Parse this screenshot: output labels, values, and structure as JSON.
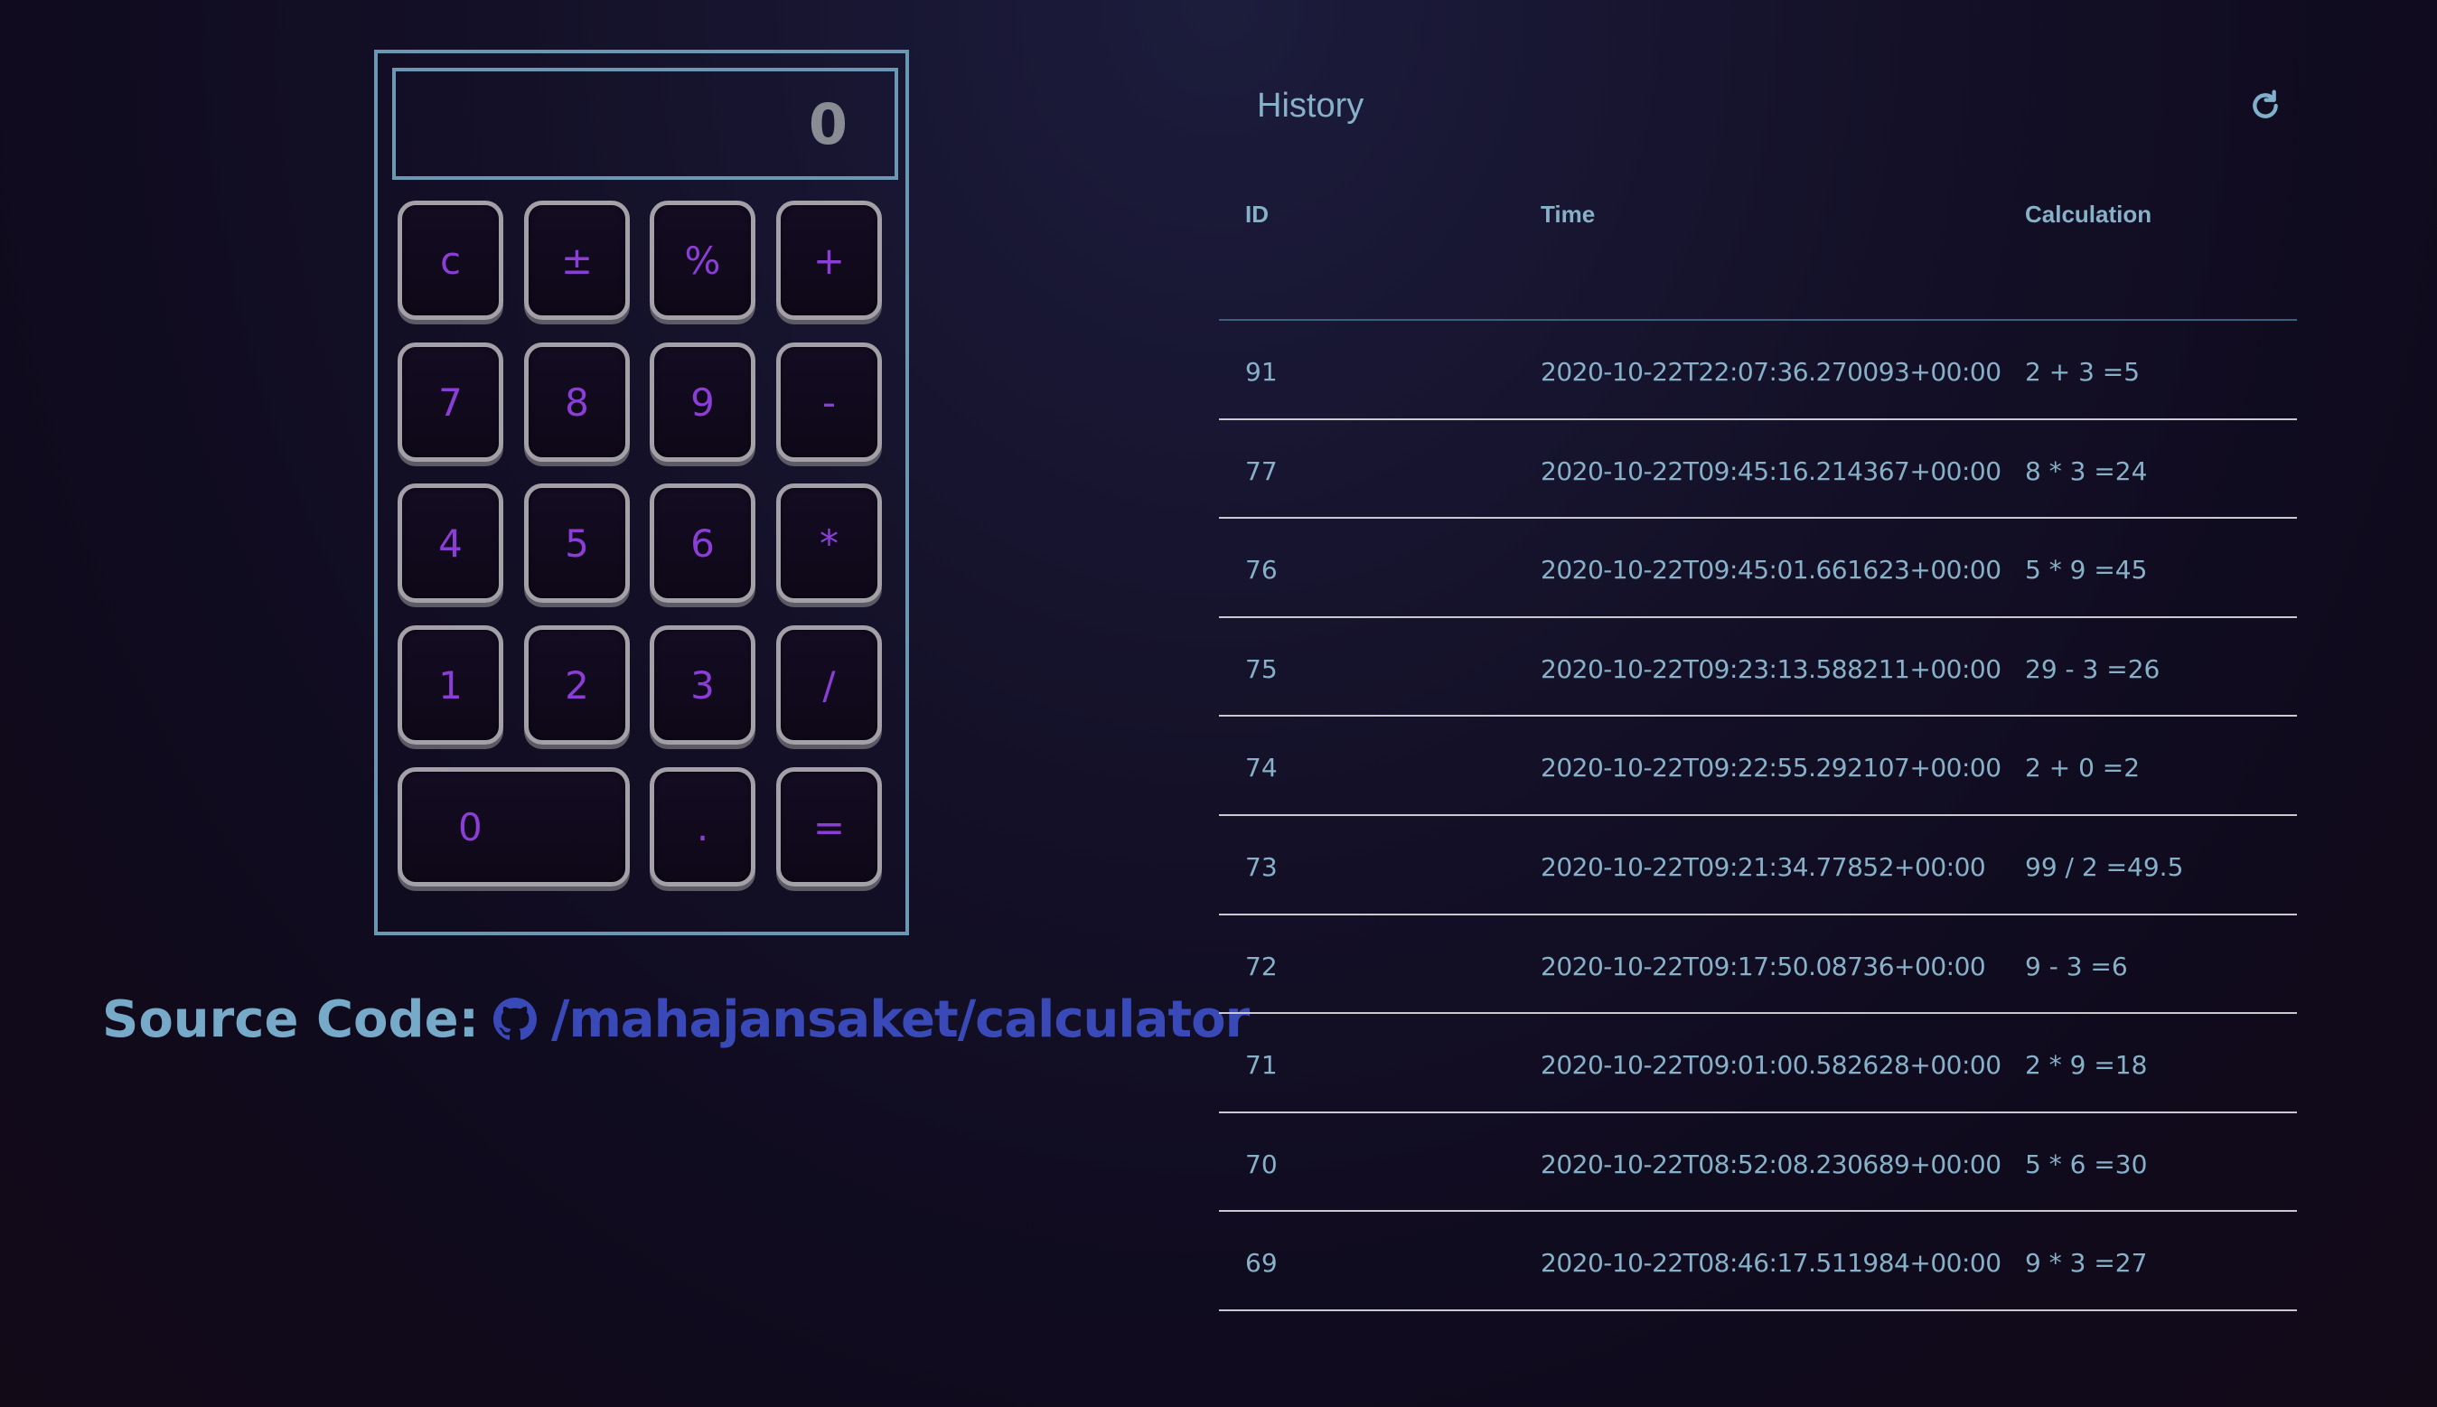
{
  "calculator": {
    "display_value": "0",
    "keys": [
      {
        "label": "c",
        "name": "clear-key"
      },
      {
        "label": "±",
        "name": "sign-toggle-key"
      },
      {
        "label": "%",
        "name": "percent-key"
      },
      {
        "label": "+",
        "name": "add-key"
      },
      {
        "label": "7",
        "name": "digit-7-key"
      },
      {
        "label": "8",
        "name": "digit-8-key"
      },
      {
        "label": "9",
        "name": "digit-9-key"
      },
      {
        "label": "-",
        "name": "subtract-key"
      },
      {
        "label": "4",
        "name": "digit-4-key"
      },
      {
        "label": "5",
        "name": "digit-5-key"
      },
      {
        "label": "6",
        "name": "digit-6-key"
      },
      {
        "label": "*",
        "name": "multiply-key"
      },
      {
        "label": "1",
        "name": "digit-1-key"
      },
      {
        "label": "2",
        "name": "digit-2-key"
      },
      {
        "label": "3",
        "name": "digit-3-key"
      },
      {
        "label": "/",
        "name": "divide-key"
      },
      {
        "label": "0",
        "name": "digit-0-key"
      },
      {
        "label": ".",
        "name": "decimal-key"
      },
      {
        "label": "=",
        "name": "equals-key"
      }
    ]
  },
  "source": {
    "label": "Source Code:",
    "link_text": "/mahajansaket/calculator",
    "icon": "github-icon"
  },
  "history": {
    "title": "History",
    "refresh_icon": "refresh-icon",
    "columns": {
      "id": "ID",
      "time": "Time",
      "calculation": "Calculation"
    },
    "rows": [
      {
        "id": "91",
        "time": "2020-10-22T22:07:36.270093+00:00",
        "calculation": "2 + 3 =5"
      },
      {
        "id": "77",
        "time": "2020-10-22T09:45:16.214367+00:00",
        "calculation": "8 * 3 =24"
      },
      {
        "id": "76",
        "time": "2020-10-22T09:45:01.661623+00:00",
        "calculation": "5 * 9 =45"
      },
      {
        "id": "75",
        "time": "2020-10-22T09:23:13.588211+00:00",
        "calculation": "29 - 3 =26"
      },
      {
        "id": "74",
        "time": "2020-10-22T09:22:55.292107+00:00",
        "calculation": "2 + 0 =2"
      },
      {
        "id": "73",
        "time": "2020-10-22T09:21:34.77852+00:00",
        "calculation": "99 / 2 =49.5"
      },
      {
        "id": "72",
        "time": "2020-10-22T09:17:50.08736+00:00",
        "calculation": "9 - 3 =6"
      },
      {
        "id": "71",
        "time": "2020-10-22T09:01:00.582628+00:00",
        "calculation": "2 * 9 =18"
      },
      {
        "id": "70",
        "time": "2020-10-22T08:52:08.230689+00:00",
        "calculation": "5 * 6 =30"
      },
      {
        "id": "69",
        "time": "2020-10-22T08:46:17.511984+00:00",
        "calculation": "9 * 3 =27"
      }
    ]
  },
  "colors": {
    "accent_purple": "#8a3ed6",
    "frame_blue": "#6a97b1",
    "text_blue": "#86b1c8",
    "link_blue": "#3a49b8"
  }
}
